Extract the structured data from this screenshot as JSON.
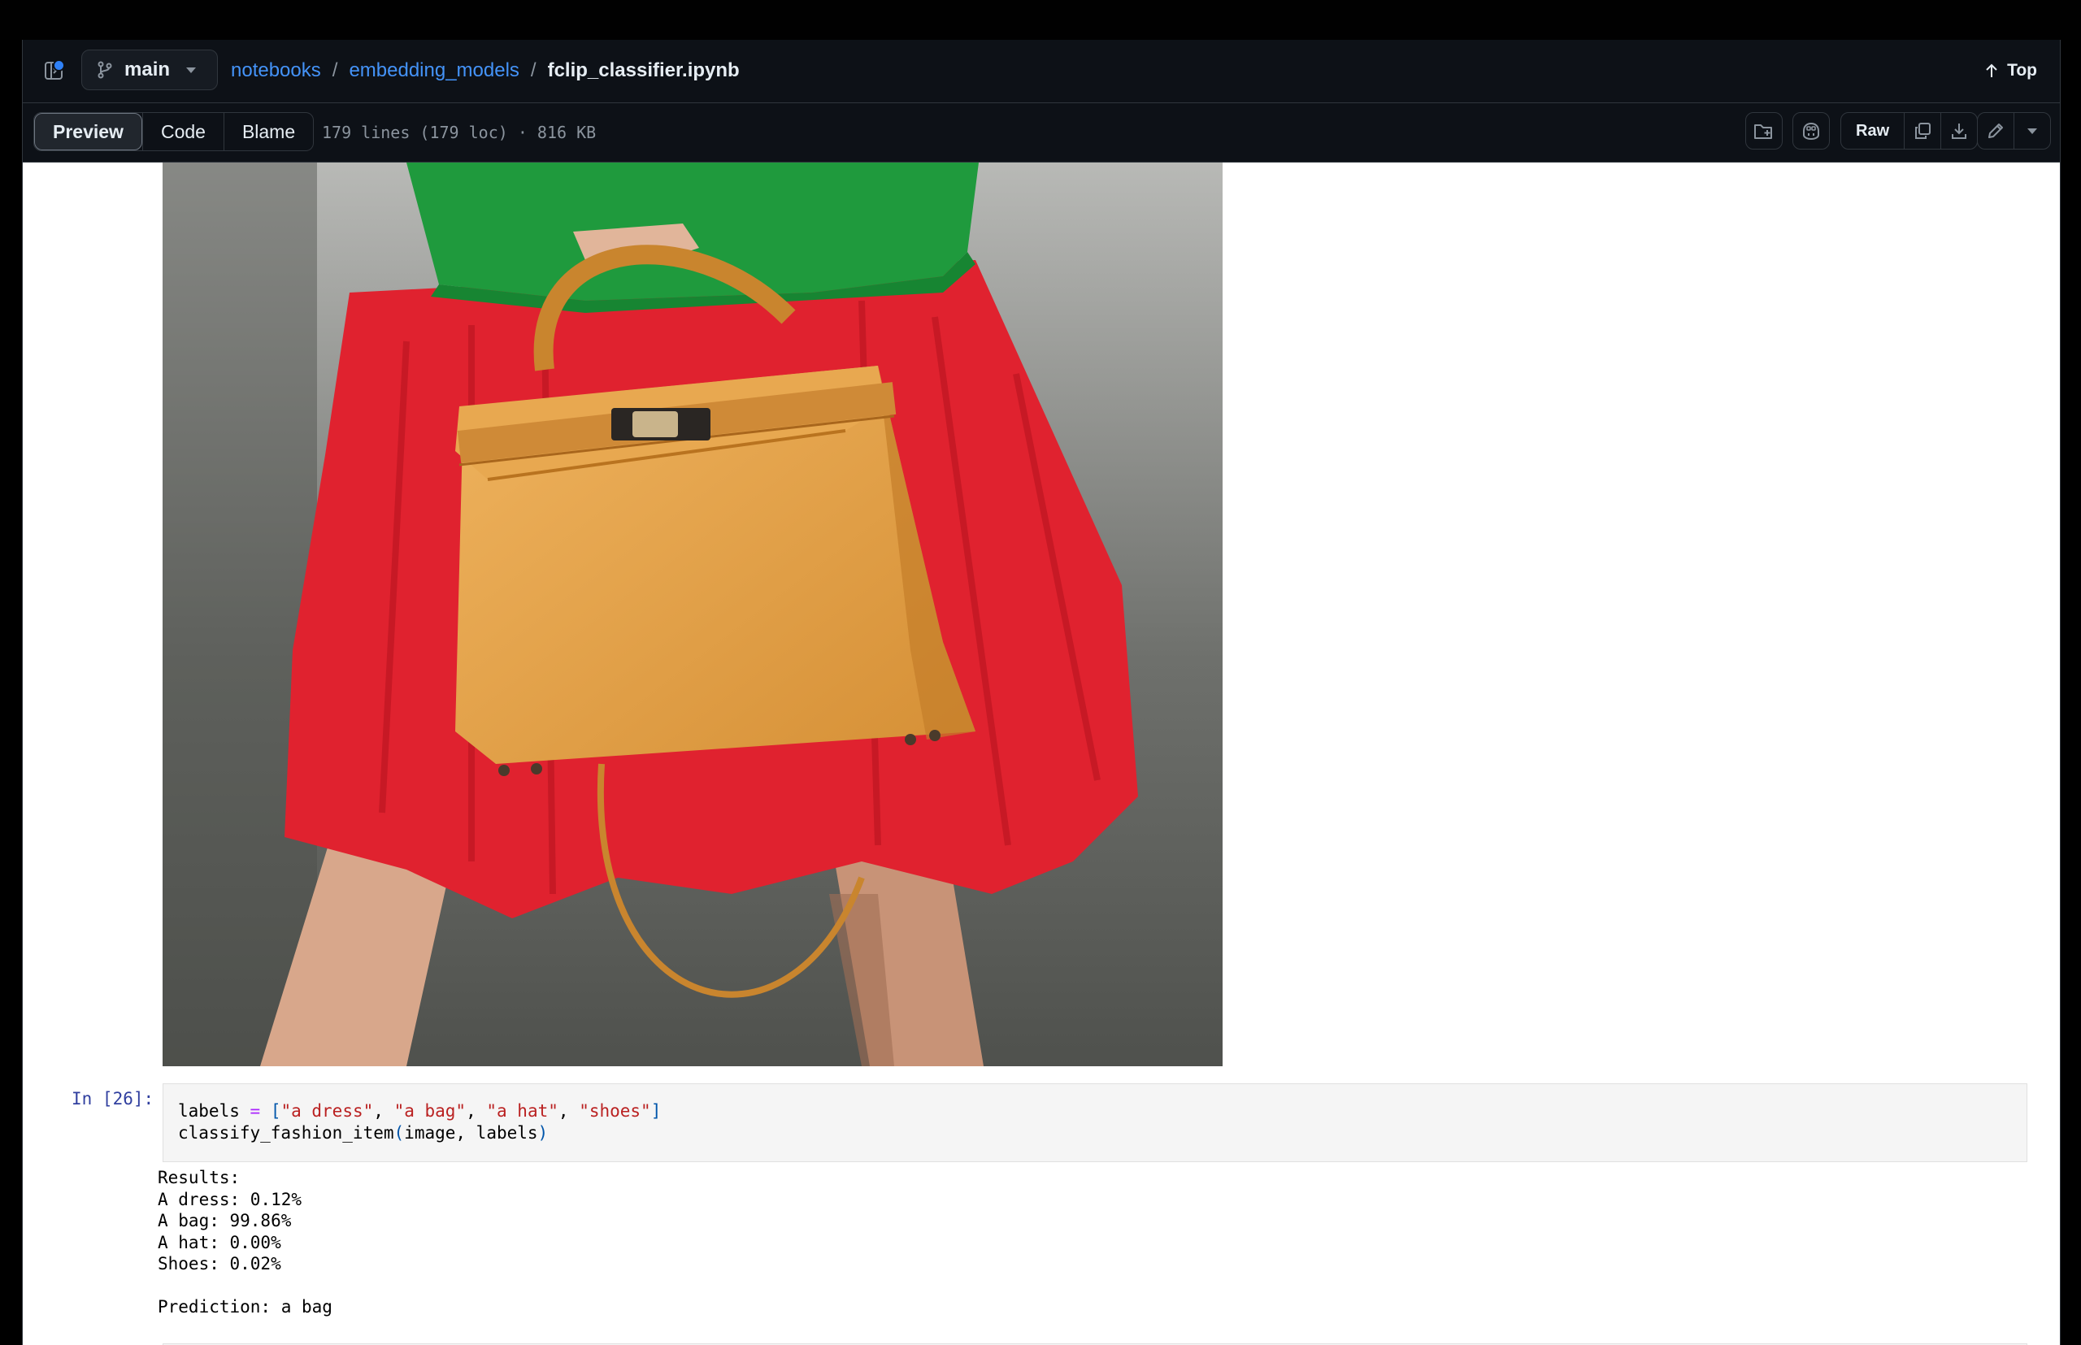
{
  "breadcrumb": {
    "branch": "main",
    "parts": [
      "notebooks",
      "embedding_models"
    ],
    "separator": "/",
    "file": "fclip_classifier.ipynb",
    "top_label": "Top"
  },
  "file_toolbar": {
    "tabs": [
      "Preview",
      "Code",
      "Blame"
    ],
    "active_tab": "Preview",
    "file_info": "179 lines (179 loc) · 816 KB",
    "raw_label": "Raw"
  },
  "notebook": {
    "image_description_alt": "fashion photo",
    "cell_prompt": "In [26]:",
    "code": {
      "line1": {
        "var": "labels ",
        "op": "=",
        "open": " [",
        "s1": "\"a dress\"",
        "c1": ", ",
        "s2": "\"a bag\"",
        "c2": ", ",
        "s3": "\"a hat\"",
        "c3": ", ",
        "s4": "\"shoes\"",
        "close": "]"
      },
      "line2": {
        "fn": "classify_fashion_item",
        "po": "(",
        "args": "image, labels",
        "pc": ")"
      }
    },
    "output_lines": [
      "Results:",
      "A dress: 0.12%",
      "A bag: 99.86%",
      "A hat: 0.00%",
      "Shoes: 0.02%",
      "",
      "Prediction: a bag"
    ]
  },
  "colors": {
    "link": "#4493f8",
    "background_dark": "#0d1117",
    "string": "#ba2121",
    "operator": "#aa22ff"
  },
  "icons": [
    "sidebar-toggle-icon",
    "git-branch-icon",
    "arrow-up-icon",
    "add-file-icon",
    "copilot-icon",
    "copy-icon",
    "download-icon",
    "pencil-icon",
    "chevron-down-icon"
  ]
}
